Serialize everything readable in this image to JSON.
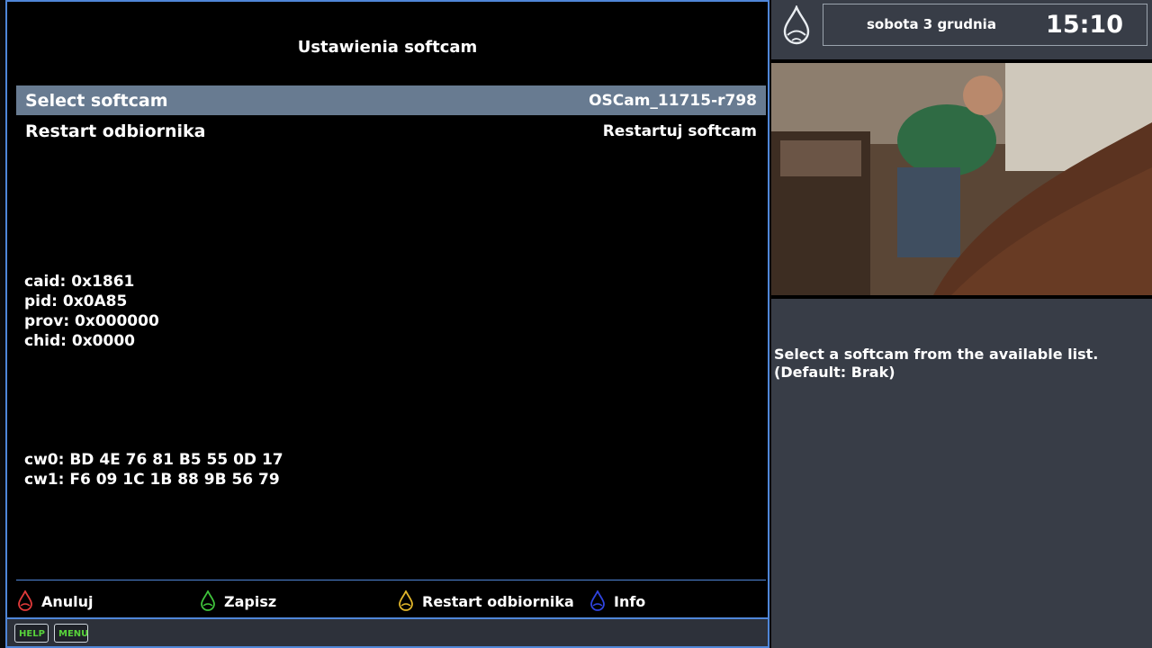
{
  "screen": {
    "title": "Ustawienia softcam",
    "menu": [
      {
        "label": "Select softcam",
        "value": "OSCam_11715-r798",
        "selected": true
      },
      {
        "label": "Restart odbiornika",
        "value": "Restartuj softcam",
        "selected": false
      }
    ],
    "ecm_info": {
      "caid": "caid: 0x1861",
      "pid": "pid: 0x0A85",
      "prov": "prov: 0x000000",
      "chid": "chid: 0x0000"
    },
    "cw": {
      "cw0": "cw0: BD 4E 76 81 B5 55 0D 17",
      "cw1": "cw1: F6 09 1C 1B 88 9B 56 79"
    },
    "footer": {
      "red": "Anuluj",
      "green": "Zapisz",
      "yellow": "Restart odbiornika",
      "blue": "Info"
    },
    "mini_buttons": {
      "help": "HELP",
      "menu": "MENU"
    }
  },
  "side": {
    "date": "sobota 3 grudnia",
    "time": "15:10",
    "help_line1": "Select a softcam from the available list.",
    "help_line2": "(Default: Brak)"
  },
  "colors": {
    "accent": "#4f86d8",
    "selected_row": "#687b91",
    "red_key": "#e23a3a",
    "green_key": "#3fc33b",
    "yellow_key": "#e2b62a",
    "blue_key": "#2f44e0"
  },
  "icons": {
    "logo": "drop-logo-icon",
    "key": "drop-key-icon"
  }
}
